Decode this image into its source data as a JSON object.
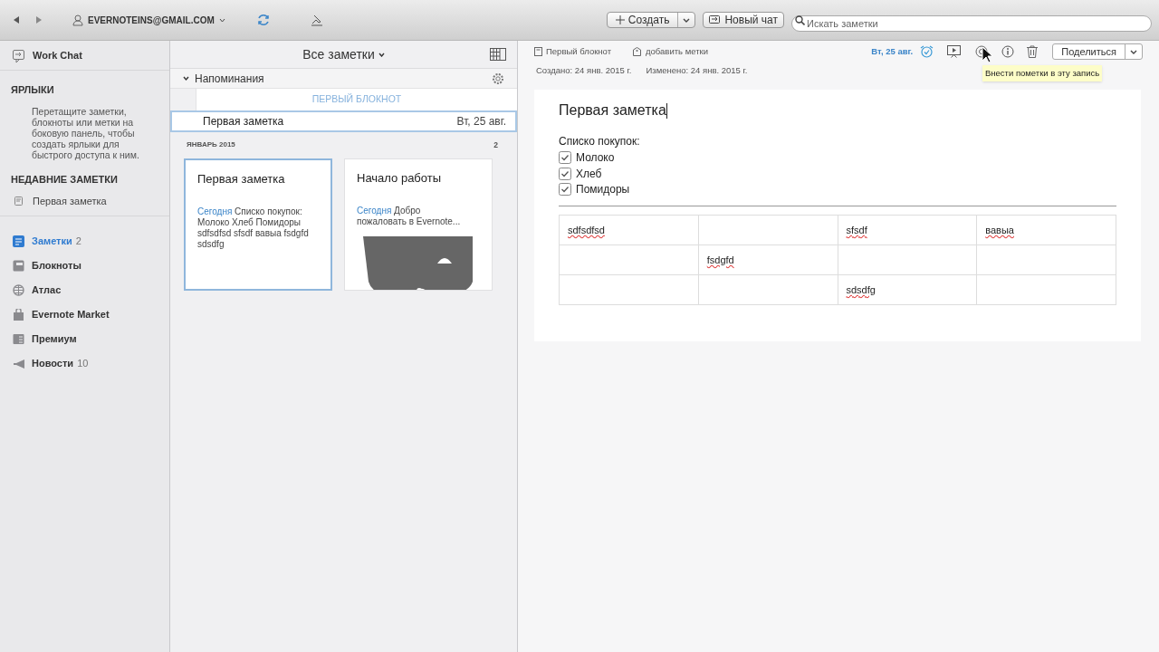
{
  "toolbar": {
    "account": "EVERNOTEINS@GMAIL.COM",
    "create_button": "Создать",
    "chat_button": "Новый чат",
    "search": {
      "placeholder": "Искать заметки"
    }
  },
  "sidebar": {
    "work_chat": "Work Chat",
    "shortcuts_heading": "ЯРЛЫКИ",
    "shortcuts_hint": "Перетащите заметки, блокноты или метки на боковую панель, чтобы создать ярлыки для быстрого доступа к ним.",
    "recent_heading": "НЕДАВНИЕ ЗАМЕТКИ",
    "recent": [
      {
        "label": "Первая заметка"
      }
    ],
    "nav": [
      {
        "kind": "notes",
        "label": "Заметки",
        "count": "2",
        "selected": true
      },
      {
        "kind": "notebooks",
        "label": "Блокноты",
        "selected": false
      },
      {
        "kind": "atlas",
        "label": "Атлас",
        "selected": false
      },
      {
        "kind": "market",
        "label": "Evernote Market",
        "selected": false
      },
      {
        "kind": "premium",
        "label": "Премиум",
        "selected": false
      },
      {
        "kind": "news",
        "label": "Новости",
        "count": "10",
        "selected": false
      }
    ]
  },
  "notes_list": {
    "title": "Все заметки",
    "reminders": {
      "label": "Напоминания",
      "expanded": true,
      "notebook": "ПЕРВЫЙ БЛОКНОТ",
      "items": [
        {
          "title": "Первая заметка",
          "date": "Вт, 25 авг.",
          "selected": true
        }
      ]
    },
    "group": {
      "label": "ЯНВАРЬ 2015",
      "count": "2"
    },
    "cards": [
      {
        "kind": "text",
        "title": "Первая заметка",
        "date": "Сегодня",
        "snippet": "Списко покупок: Молоко Хлеб Помидоры sdfsdfsd sfsdf вавыа fsdgfd sdsdfg",
        "selected": true
      },
      {
        "kind": "picture",
        "title": "Начало работы",
        "date": "Сегодня",
        "snippet": "Добро пожаловать в Evernote...",
        "selected": false
      }
    ]
  },
  "editor": {
    "notebook": "Первый блокнот",
    "tags": "добавить метки",
    "reminder_date": "Вт, 25 авг.",
    "share_button": "Поделиться",
    "tooltip": "Внести пометки в эту запись",
    "created": "Создано: 24 янв. 2015 г.",
    "modified": "Изменено: 24 янв. 2015 г.",
    "title": "Первая заметка",
    "list_title": "Списко покупок:",
    "checklist": [
      {
        "label": "Молоко",
        "checked": true
      },
      {
        "label": "Хлеб",
        "checked": true
      },
      {
        "label": "Помидоры",
        "checked": true
      }
    ],
    "table": {
      "rows": [
        [
          "sdfsdfsd",
          null,
          "sfsdf",
          "вавыа"
        ],
        [
          null,
          "fsdgfd",
          null,
          null
        ],
        [
          null,
          null,
          "sdsdfg",
          null
        ]
      ]
    }
  }
}
